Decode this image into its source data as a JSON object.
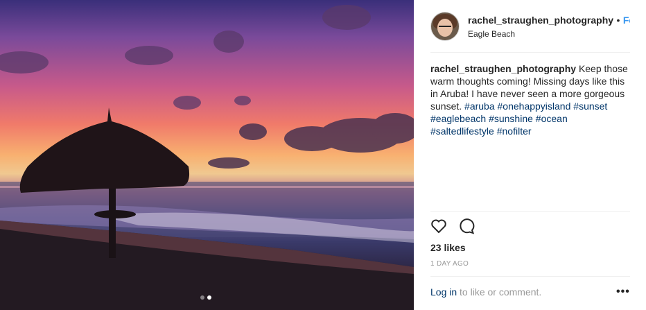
{
  "post": {
    "username": "rachel_straughen_photography",
    "separator": "•",
    "follow_label": "Follo",
    "location": "Eagle Beach"
  },
  "caption": {
    "username": "rachel_straughen_photography",
    "text": "Keep those warm thoughts coming! Missing days like this in Aruba! I have never seen a more gorgeous sunset.",
    "hashtags": [
      "#aruba",
      "#onehappyisland",
      "#sunset",
      "#eaglebeach",
      "#sunshine",
      "#ocean",
      "#saltedlifestyle",
      "#nofilter"
    ]
  },
  "engagement": {
    "likes": "23 likes",
    "time": "1 DAY AGO"
  },
  "footer": {
    "login_link": "Log in",
    "login_rest": " to like or comment.",
    "more_label": "•••"
  },
  "carousel": {
    "count": 2,
    "active_index": 1
  },
  "icons": {
    "like": "heart-icon",
    "comment": "comment-icon",
    "more": "more-options-icon"
  },
  "colors": {
    "link_blue": "#3897f0",
    "hashtag": "#003569",
    "muted": "#999999"
  }
}
